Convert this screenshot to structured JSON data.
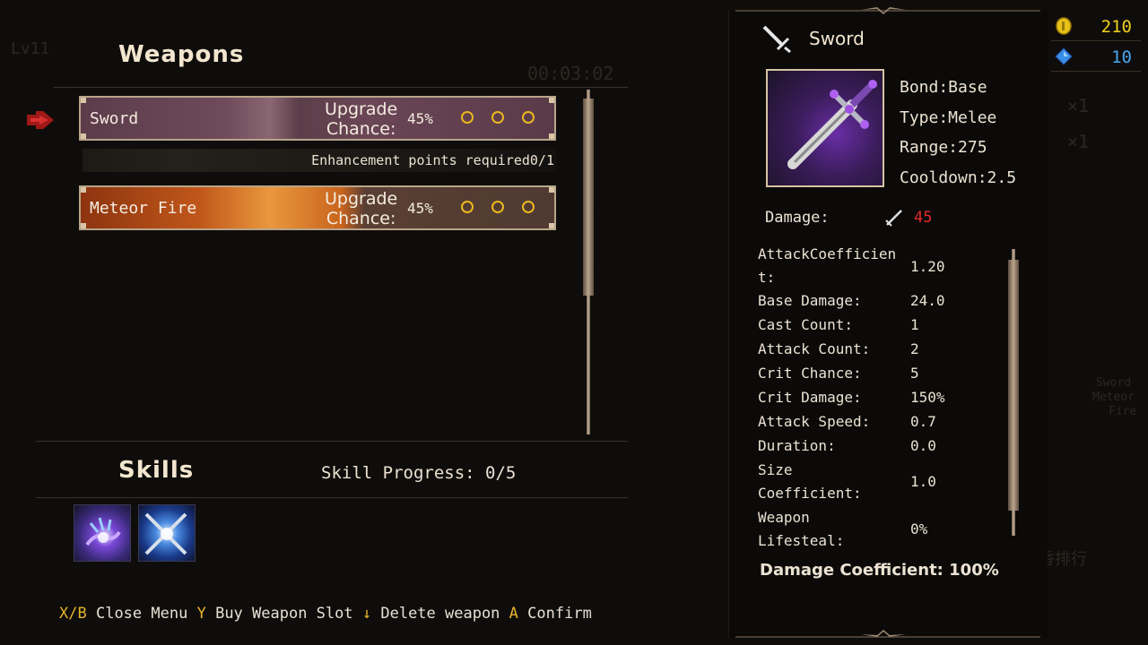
{
  "background_faint": {
    "level": "Lv11",
    "timer": "00:03:02",
    "multiplier_1": "×1",
    "multiplier_2": "×1",
    "weapon_list": [
      "Sword",
      "Meteor",
      "Fire"
    ],
    "bottom_right": "随香排行"
  },
  "weapons_section": {
    "title": "Weapons",
    "items": [
      {
        "name": "Sword",
        "upgrade_line1": "Upgrade",
        "upgrade_line2": "Chance:",
        "chance": "45%",
        "slots": 3
      },
      {
        "name": "Meteor Fire",
        "upgrade_line1": "Upgrade",
        "upgrade_line2": "Chance:",
        "chance": "45%",
        "slots": 3
      }
    ],
    "enhancement_text": "Enhancement points required0/1"
  },
  "skills_section": {
    "title": "Skills",
    "progress": "Skill Progress: 0/5",
    "icons": [
      "magic-hand-skill-icon",
      "crossed-swords-skill-icon"
    ]
  },
  "controls": {
    "close_key": "X/B",
    "close_label": "Close Menu",
    "buy_key": "Y",
    "buy_label": "Buy Weapon Slot",
    "delete_key": "↓",
    "delete_label": "Delete weapon",
    "confirm_key": "A",
    "confirm_label": "Confirm"
  },
  "detail": {
    "title": "Sword",
    "bond": "Bond:Base",
    "type": "Type:Melee",
    "range": "Range:275",
    "cooldown": "Cooldown:2.5",
    "damage_label": "Damage:",
    "damage_value": "45",
    "stats": [
      {
        "label": "AttackCoefficien\nt:",
        "value": "1.20"
      },
      {
        "label": "Base Damage:",
        "value": "24.0"
      },
      {
        "label": "Cast Count:",
        "value": "1"
      },
      {
        "label": "Attack Count:",
        "value": "2"
      },
      {
        "label": "Crit Chance:",
        "value": "5"
      },
      {
        "label": "Crit Damage:",
        "value": "150%"
      },
      {
        "label": "Attack Speed:",
        "value": "0.7"
      },
      {
        "label": "Duration:",
        "value": "0.0"
      },
      {
        "label": "Size\nCoefficient:",
        "value": "1.0"
      },
      {
        "label": "Weapon\nLifesteal:",
        "value": "0%"
      }
    ],
    "damage_coefficient": "Damage Coefficient: 100%"
  },
  "currency": {
    "gold": "210",
    "gems": "10",
    "gold_color": "#f0d020",
    "gem_color": "#4aa8f0"
  },
  "colors": {
    "accent_key": "#e6b32c",
    "damage_red": "#e02a2a",
    "title_cream": "#f2e6cf"
  }
}
